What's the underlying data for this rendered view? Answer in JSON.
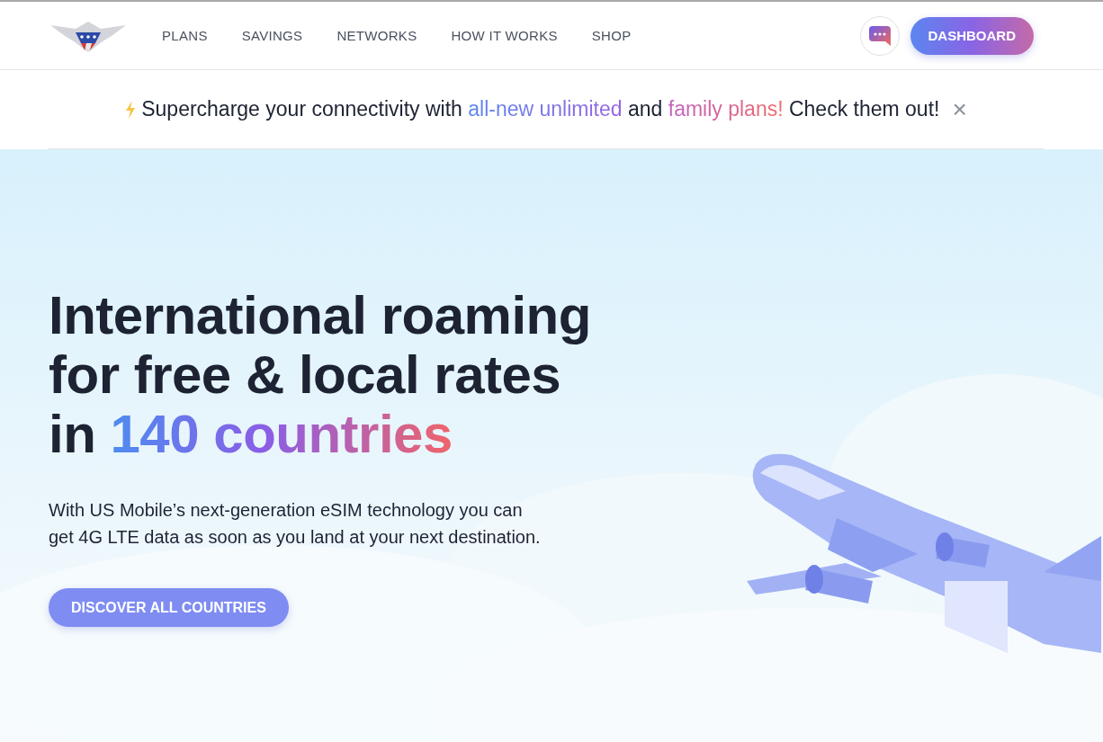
{
  "nav": {
    "links": [
      "PLANS",
      "SAVINGS",
      "NETWORKS",
      "HOW IT WORKS",
      "SHOP"
    ],
    "dashboard_button": "DASHBOARD"
  },
  "banner": {
    "parts": [
      {
        "kind": "text",
        "text": "Supercharge your connectivity with "
      },
      {
        "kind": "link",
        "text": "all-new unlimited"
      },
      {
        "kind": "text",
        "text": " and "
      },
      {
        "kind": "link",
        "text": "family plans!"
      },
      {
        "kind": "text",
        "text": " Check them out!"
      }
    ],
    "close": "×"
  },
  "hero": {
    "headline_lines": [
      "International roaming",
      "for free & local rates"
    ],
    "headline_last": "in ",
    "headline_highlight": "140 countries",
    "description": "With US Mobile’s next-generation eSIM technology you can get 4G LTE data as soon as you land at your next destination.",
    "cta": "DISCOVER ALL COUNTRIES"
  }
}
